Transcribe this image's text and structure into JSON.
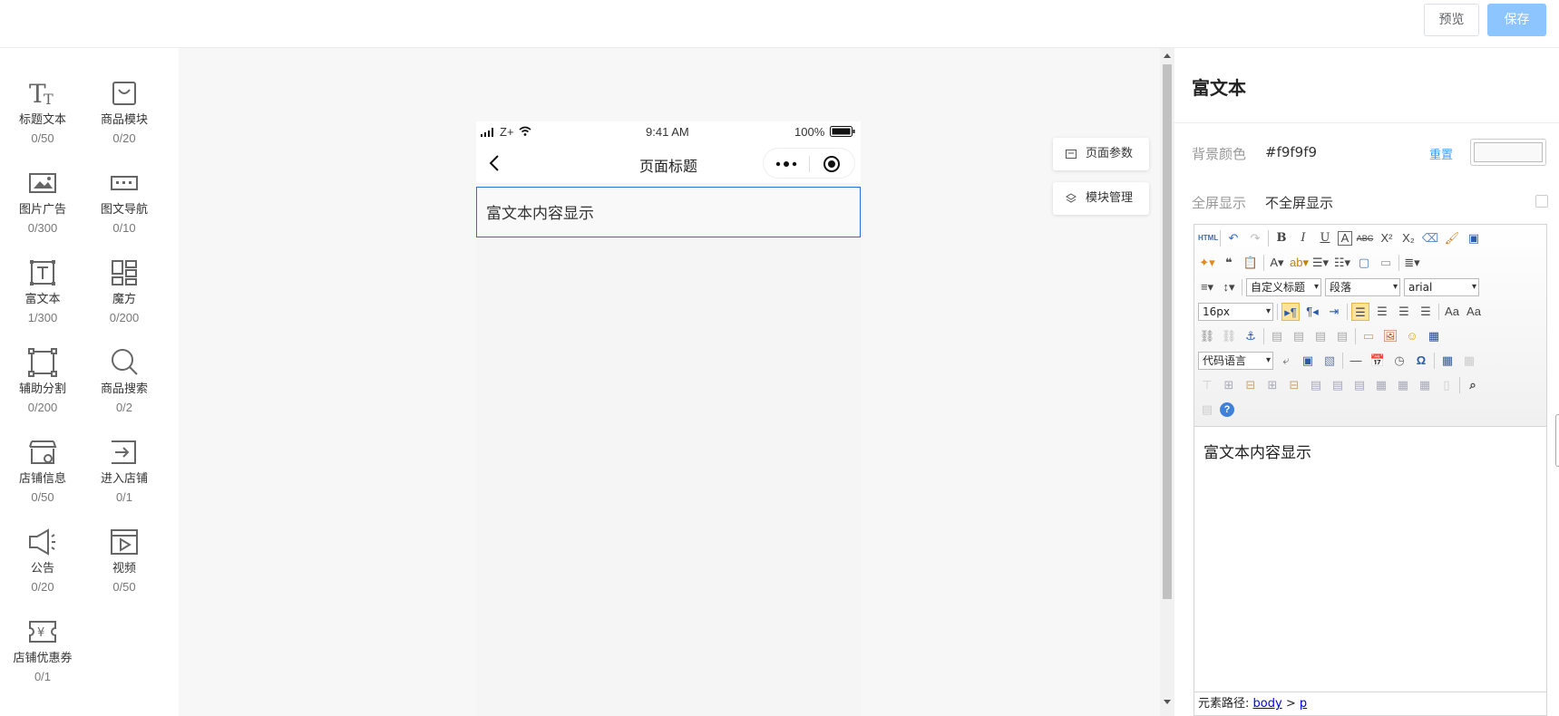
{
  "header": {
    "preview_label": "预览",
    "save_label": "保存"
  },
  "palette": [
    {
      "label": "标题文本",
      "count": "0/50",
      "icon": "title-text-icon"
    },
    {
      "label": "商品模块",
      "count": "0/20",
      "icon": "shopping-bag-icon"
    },
    {
      "label": "图片广告",
      "count": "0/300",
      "icon": "image-ad-icon"
    },
    {
      "label": "图文导航",
      "count": "0/10",
      "icon": "image-nav-icon"
    },
    {
      "label": "富文本",
      "count": "1/300",
      "icon": "rich-text-icon"
    },
    {
      "label": "魔方",
      "count": "0/200",
      "icon": "magic-cube-icon"
    },
    {
      "label": "辅助分割",
      "count": "0/200",
      "icon": "divider-icon"
    },
    {
      "label": "商品搜索",
      "count": "0/2",
      "icon": "search-icon"
    },
    {
      "label": "店铺信息",
      "count": "0/50",
      "icon": "store-info-icon"
    },
    {
      "label": "进入店铺",
      "count": "0/1",
      "icon": "enter-store-icon"
    },
    {
      "label": "公告",
      "count": "0/20",
      "icon": "announcement-icon"
    },
    {
      "label": "视频",
      "count": "0/50",
      "icon": "video-icon"
    },
    {
      "label": "店铺优惠券",
      "count": "0/1",
      "icon": "coupon-icon"
    }
  ],
  "phone": {
    "carrier": "Z+",
    "time": "9:41 AM",
    "battery": "100%",
    "page_title": "页面标题",
    "rich_text_content": "富文本内容显示"
  },
  "side_buttons": {
    "page_params": "页面参数",
    "module_manage": "模块管理"
  },
  "panel": {
    "title": "富文本",
    "bg_color_label": "背景颜色",
    "bg_color_value": "#f9f9f9",
    "reset_label": "重置",
    "fullscreen_label": "全屏显示",
    "fullscreen_value": "不全屏显示",
    "toolbar": {
      "html_label": "HTML",
      "custom_heading": "自定义标题",
      "paragraph": "段落",
      "font_family": "arial",
      "font_size": "16px",
      "code_language": "代码语言"
    },
    "editor_content": "富文本内容显示",
    "path_label": "元素路径:",
    "path_body": "body",
    "path_sep": ">",
    "path_p": "p"
  }
}
